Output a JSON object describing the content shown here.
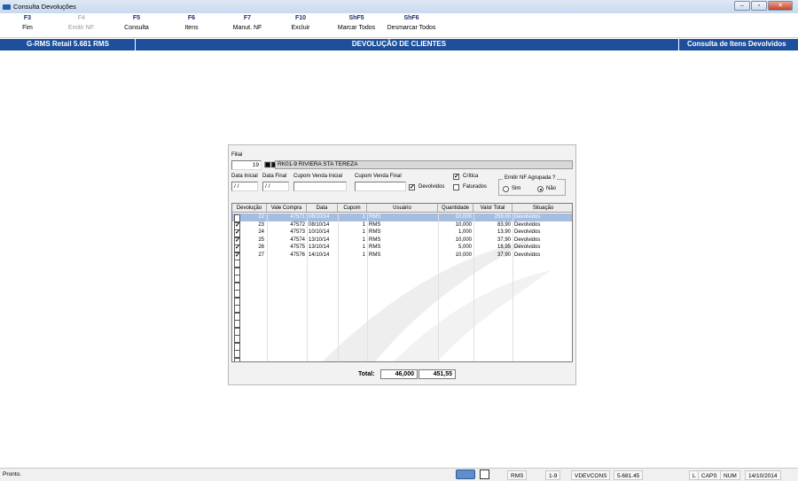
{
  "window": {
    "title": "Consulta Devoluções",
    "min": "–",
    "max": "▫",
    "close": "✕"
  },
  "fkeys": [
    {
      "key": "F3",
      "label": "Fim",
      "enabled": true
    },
    {
      "key": "F4",
      "label": "Emitir NF.",
      "enabled": false
    },
    {
      "key": "F5",
      "label": "Consulta",
      "enabled": true
    },
    {
      "key": "F6",
      "label": "Itens",
      "enabled": true
    },
    {
      "key": "F7",
      "label": "Manut. NF",
      "enabled": true
    },
    {
      "key": "F10",
      "label": "Excluir",
      "enabled": true
    },
    {
      "key": "ShF5",
      "label": "Marcar Todos",
      "enabled": true
    },
    {
      "key": "ShF6",
      "label": "Desmarcar Todos",
      "enabled": true
    }
  ],
  "header": {
    "left": "G-RMS Retail 5.681 RMS",
    "center": "DEVOLUÇÃO DE CLIENTES",
    "right": "Consulta de Itens Devolvidos"
  },
  "form": {
    "filial_label": "Filial",
    "filial_value": "19",
    "filial_name": "RK01-9 RIVIERA STA TEREZA",
    "data_inicial_label": "Data Inicial",
    "data_inicial_value": "/ /",
    "data_final_label": "Data Final",
    "data_final_value": "/ /",
    "cupom_ini_label": "Cupom Venda Inicial",
    "cupom_ini_value": "",
    "cupom_fin_label": "Cupom Venda Final",
    "cupom_fin_value": "",
    "critica_label": "Crítica",
    "critica_checked": true,
    "devolvidos_label": "Devolvidos",
    "devolvidos_checked": true,
    "faturados_label": "Faturados",
    "faturados_checked": false,
    "emitir_group_label": "Emitir NF Agrupada ?",
    "sim_label": "Sim",
    "nao_label": "Não",
    "emitir_selected": "Não"
  },
  "grid": {
    "columns": [
      "Devolução",
      "Vale Compra",
      "Data",
      "Cupom",
      "Usuário",
      "Quantidade",
      "Valor Total",
      "Situação"
    ],
    "rows": [
      {
        "checked": true,
        "dev": "22",
        "vale": "47571",
        "data": "08/10/14",
        "cupom": "1",
        "usuario": "RMS",
        "qtd": "10,000",
        "valor": "259,00",
        "situacao": "Devolvidos",
        "selected": true
      },
      {
        "checked": true,
        "dev": "23",
        "vale": "47572",
        "data": "08/10/14",
        "cupom": "1",
        "usuario": "RMS",
        "qtd": "10,000",
        "valor": "83,90",
        "situacao": "Devolvidos"
      },
      {
        "checked": true,
        "dev": "24",
        "vale": "47573",
        "data": "10/10/14",
        "cupom": "1",
        "usuario": "RMS",
        "qtd": "1,000",
        "valor": "13,90",
        "situacao": "Devolvidos"
      },
      {
        "checked": true,
        "dev": "25",
        "vale": "47574",
        "data": "13/10/14",
        "cupom": "1",
        "usuario": "RMS",
        "qtd": "10,000",
        "valor": "37,90",
        "situacao": "Devolvidos"
      },
      {
        "checked": true,
        "dev": "26",
        "vale": "47575",
        "data": "13/10/14",
        "cupom": "1",
        "usuario": "RMS",
        "qtd": "5,000",
        "valor": "18,95",
        "situacao": "Devolvidos"
      },
      {
        "checked": true,
        "dev": "27",
        "vale": "47576",
        "data": "14/10/14",
        "cupom": "1",
        "usuario": "RMS",
        "qtd": "10,000",
        "valor": "37,90",
        "situacao": "Devolvidos"
      }
    ],
    "empty_rows": 14
  },
  "totals": {
    "label": "Total:",
    "quantidade": "46,000",
    "valor": "451,55"
  },
  "status": {
    "text": "Pronto.",
    "user": "RMS",
    "page": "1-9",
    "program": "VDEVCONS",
    "version": "5.681.45",
    "l": "L",
    "caps": "CAPS",
    "num": "NUM",
    "date": "14/10/2014"
  },
  "colors": {
    "header_blue": "#1e4f9c",
    "selected_row": "#a5bde1"
  }
}
